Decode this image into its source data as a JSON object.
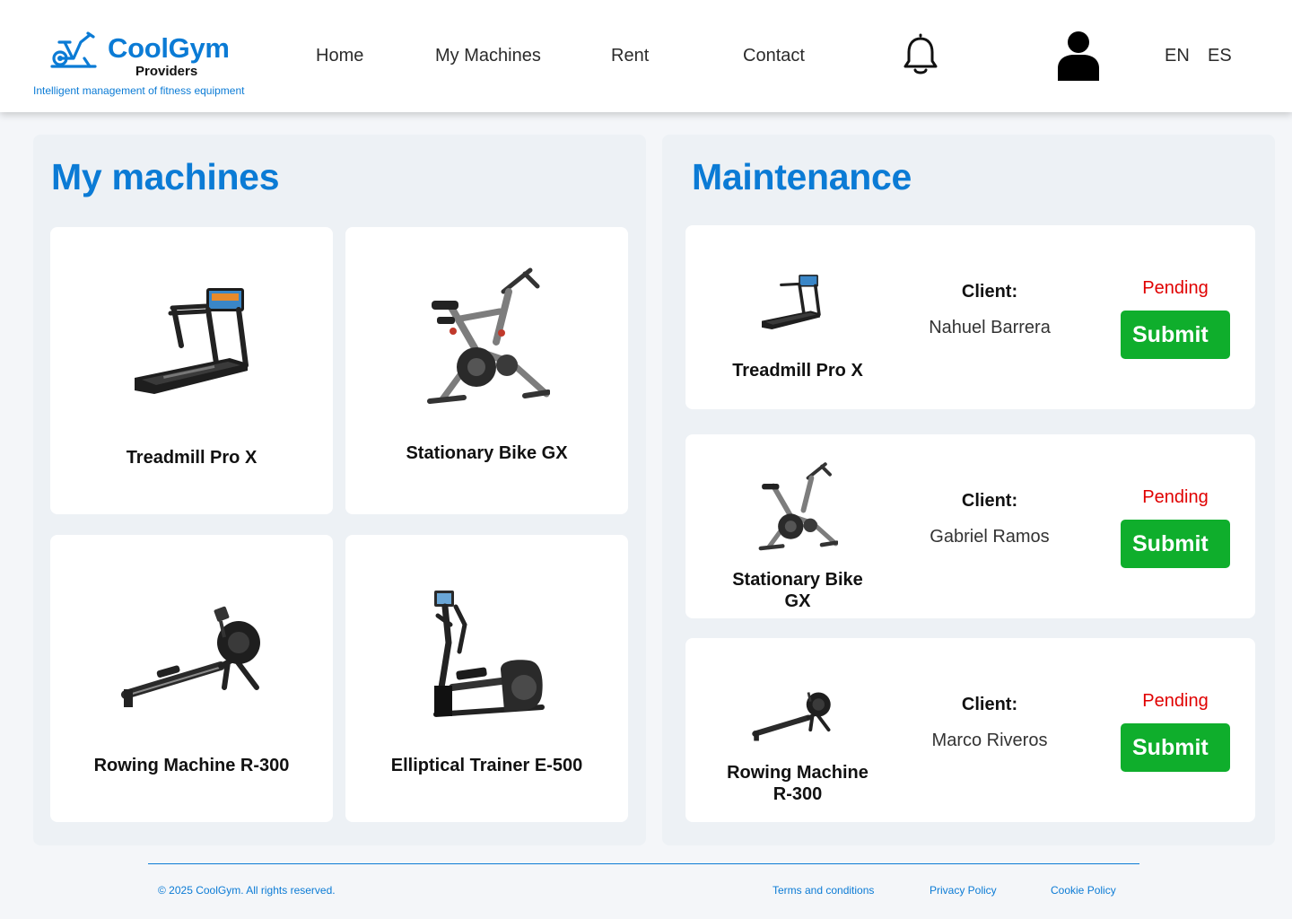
{
  "brand": {
    "name": "CoolGym",
    "subtitle": "Providers",
    "tagline": "Intelligent management of fitness equipment",
    "accent_color": "#0b7bd5"
  },
  "nav": {
    "items": [
      {
        "label": "Home"
      },
      {
        "label": "My Machines"
      },
      {
        "label": "Rent"
      },
      {
        "label": "Contact"
      }
    ],
    "notification_icon": "bell-icon",
    "profile_icon": "user-icon",
    "languages": [
      "EN",
      "ES"
    ]
  },
  "my_machines": {
    "title": "My machines",
    "machines": [
      {
        "name": "Treadmill Pro X",
        "icon": "treadmill"
      },
      {
        "name": "Stationary Bike GX",
        "icon": "stationary-bike"
      },
      {
        "name": "Rowing Machine R-300",
        "icon": "rowing-machine"
      },
      {
        "name": "Elliptical Trainer E-500",
        "icon": "elliptical-trainer"
      }
    ]
  },
  "maintenance": {
    "title": "Maintenance",
    "status_color": "#e00000",
    "button_color": "#0fae2c",
    "requests": [
      {
        "machine_line1": "Treadmill Pro X",
        "machine_line2": "",
        "client_label": "Client:",
        "client_name": "Nahuel Barrera",
        "status": "Pending",
        "button": "Submit"
      },
      {
        "machine_line1": "Stationary Bike GX",
        "machine_line2": "",
        "client_label": "Client:",
        "client_name": "Gabriel Ramos",
        "status": "Pending",
        "button": "Submit"
      },
      {
        "machine_line1": "Rowing Machine",
        "machine_line2": "R-300",
        "client_label": "Client:",
        "client_name": "Marco Riveros",
        "status": "Pending",
        "button": "Submit"
      }
    ]
  },
  "footer": {
    "copyright": "© 2025 CoolGym. All rights reserved.",
    "links": [
      "Terms and conditions",
      "Privacy Policy",
      "Cookie Policy"
    ]
  }
}
